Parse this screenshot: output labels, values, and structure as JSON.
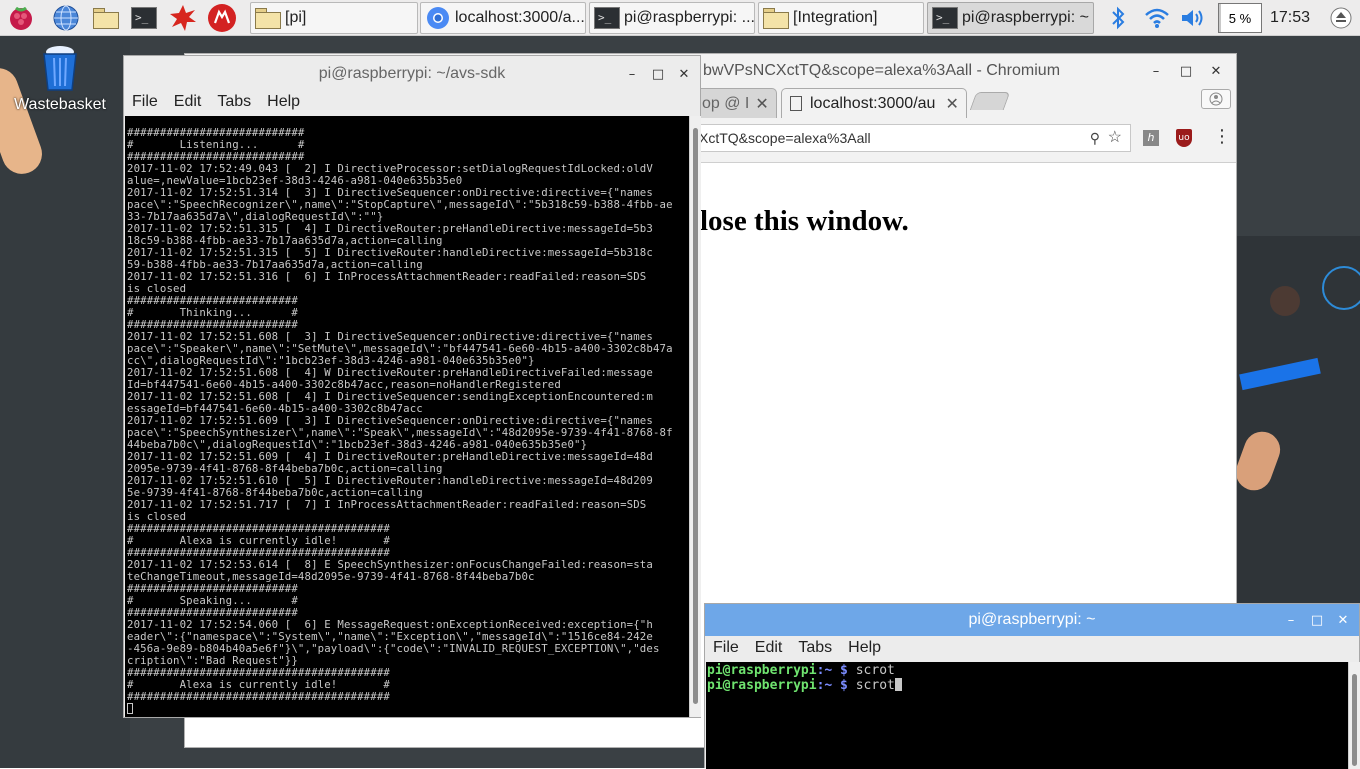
{
  "taskbar": {
    "launchers": [
      {
        "name": "raspberry-menu-icon"
      },
      {
        "name": "web-browser-icon"
      },
      {
        "name": "file-manager-icon"
      },
      {
        "name": "terminal-icon"
      },
      {
        "name": "burst-app-icon"
      },
      {
        "name": "wolfram-icon"
      }
    ],
    "tasks": [
      {
        "label": "[pi]",
        "icon": "folder-icon",
        "active": false
      },
      {
        "label": "localhost:3000/a...",
        "icon": "chromium-icon",
        "active": false
      },
      {
        "label": "pi@raspberrypi: ...",
        "icon": "terminal-icon",
        "active": false
      },
      {
        "label": "[Integration]",
        "icon": "folder-icon",
        "active": false
      },
      {
        "label": "pi@raspberrypi: ~",
        "icon": "terminal-icon",
        "active": true
      }
    ],
    "tray": {
      "bluetooth_icon": "bluetooth-icon",
      "wifi_icon": "wifi-icon",
      "volume_icon": "volume-icon",
      "cpu_label": "5 %",
      "cpu_fraction": 0.05,
      "clock": "17:53"
    },
    "eject_icon": "eject-icon"
  },
  "desktop": {
    "icons": [
      {
        "label": "Wastebasket",
        "icon": "wastebasket-icon"
      }
    ]
  },
  "chromium": {
    "title": "bwVPsNCXctTQ&scope=alexa%3Aall - Chromium",
    "tabs": [
      {
        "label": "op @ I",
        "active": false
      },
      {
        "label": "localhost:3000/au",
        "active": true
      }
    ],
    "url": "XctTQ&scope=alexa%3Aall",
    "page_text": "lose this window."
  },
  "terminal1": {
    "title": "pi@raspberrypi: ~/avs-sdk",
    "menu": [
      "File",
      "Edit",
      "Tabs",
      "Help"
    ],
    "lines": [
      "###########################",
      "#       Listening...      #",
      "###########################",
      "2017-11-02 17:52:49.043 [  2] I DirectiveProcessor:setDialogRequestIdLocked:oldV",
      "alue=,newValue=1bcb23ef-38d3-4246-a981-040e635b35e0",
      "2017-11-02 17:52:51.314 [  3] I DirectiveSequencer:onDirective:directive={\"names",
      "pace\\\":\"SpeechRecognizer\\\",name\\\":\"StopCapture\\\",messageId\\\":\"5b318c59-b388-4fbb-ae",
      "33-7b17aa635d7a\\\",dialogRequestId\\\":\"\"}",
      "2017-11-02 17:52:51.315 [  4] I DirectiveRouter:preHandleDirective:messageId=5b3",
      "18c59-b388-4fbb-ae33-7b17aa635d7a,action=calling",
      "2017-11-02 17:52:51.315 [  5] I DirectiveRouter:handleDirective:messageId=5b318c",
      "59-b388-4fbb-ae33-7b17aa635d7a,action=calling",
      "2017-11-02 17:52:51.316 [  6] I InProcessAttachmentReader:readFailed:reason=SDS",
      "is closed",
      "##########################",
      "#       Thinking...      #",
      "##########################",
      "2017-11-02 17:52:51.608 [  3] I DirectiveSequencer:onDirective:directive={\"names",
      "pace\\\":\"Speaker\\\",name\\\":\"SetMute\\\",messageId\\\":\"bf447541-6e60-4b15-a400-3302c8b47a",
      "cc\\\",dialogRequestId\\\":\"1bcb23ef-38d3-4246-a981-040e635b35e0\"}",
      "2017-11-02 17:52:51.608 [  4] W DirectiveRouter:preHandleDirectiveFailed:message",
      "Id=bf447541-6e60-4b15-a400-3302c8b47acc,reason=noHandlerRegistered",
      "2017-11-02 17:52:51.608 [  4] I DirectiveSequencer:sendingExceptionEncountered:m",
      "essageId=bf447541-6e60-4b15-a400-3302c8b47acc",
      "2017-11-02 17:52:51.609 [  3] I DirectiveSequencer:onDirective:directive={\"names",
      "pace\\\":\"SpeechSynthesizer\\\",name\\\":\"Speak\\\",messageId\\\":\"48d2095e-9739-4f41-8768-8f",
      "44beba7b0c\\\",dialogRequestId\\\":\"1bcb23ef-38d3-4246-a981-040e635b35e0\"}",
      "2017-11-02 17:52:51.609 [  4] I DirectiveRouter:preHandleDirective:messageId=48d",
      "2095e-9739-4f41-8768-8f44beba7b0c,action=calling",
      "2017-11-02 17:52:51.610 [  5] I DirectiveRouter:handleDirective:messageId=48d209",
      "5e-9739-4f41-8768-8f44beba7b0c,action=calling",
      "2017-11-02 17:52:51.717 [  7] I InProcessAttachmentReader:readFailed:reason=SDS",
      "is closed",
      "########################################",
      "#       Alexa is currently idle!       #",
      "########################################",
      "2017-11-02 17:52:53.614 [  8] E SpeechSynthesizer:onFocusChangeFailed:reason=sta",
      "teChangeTimeout,messageId=48d2095e-9739-4f41-8768-8f44beba7b0c",
      "##########################",
      "#       Speaking...      #",
      "##########################",
      "2017-11-02 17:52:54.060 [  6] E MessageRequest:onExceptionReceived:exception={\"h",
      "eader\\\":{\"namespace\\\":\"System\\\",\"name\\\":\"Exception\\\",\"messageId\\\":\"1516ce84-242e",
      "-456a-9e89-b804b40a5e6f\"}\\\",\"payload\\\":{\"code\\\":\"INVALID_REQUEST_EXCEPTION\\\",\"des",
      "cription\\\":\"Bad Request\"}}",
      "########################################",
      "#       Alexa is currently idle!       #",
      "########################################"
    ]
  },
  "terminal2": {
    "title": "pi@raspberrypi: ~",
    "menu": [
      "File",
      "Edit",
      "Tabs",
      "Help"
    ],
    "prompt_user": "pi@raspberrypi",
    "prompt_path": ":~ $",
    "commands": [
      "scrot",
      "scrot"
    ]
  }
}
